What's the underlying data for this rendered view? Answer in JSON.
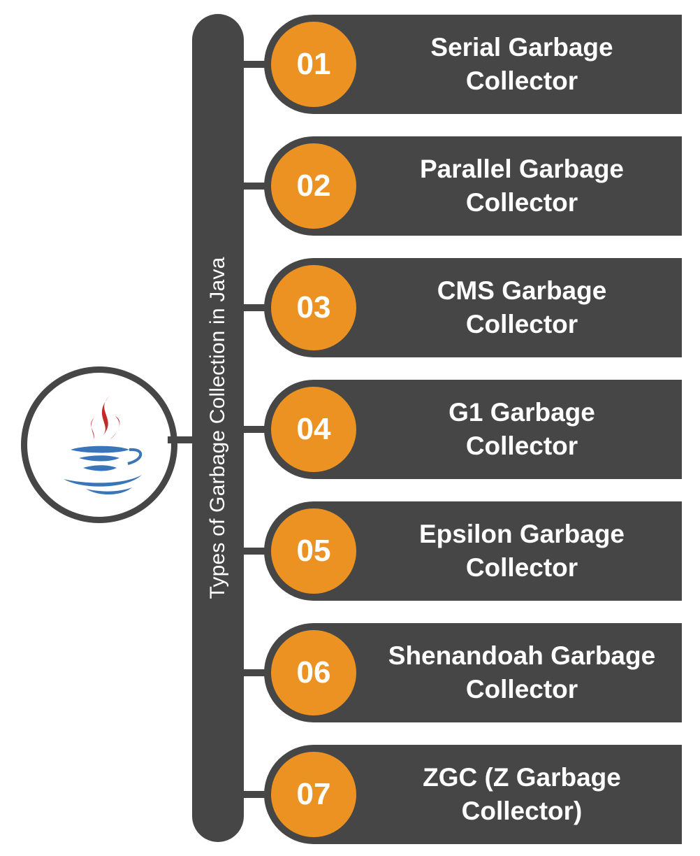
{
  "title": "Types of Garbage Collection in Java",
  "logo": {
    "icon": "java-coffee-cup-icon",
    "colors": {
      "steam": "#c32a2a",
      "cup": "#3a75b9"
    }
  },
  "colors": {
    "dark": "#464646",
    "accent": "#ec9222",
    "text": "#ffffff"
  },
  "items": [
    {
      "number": "01",
      "line1": "Serial Garbage",
      "line2": "Collector"
    },
    {
      "number": "02",
      "line1": "Parallel Garbage",
      "line2": "Collector"
    },
    {
      "number": "03",
      "line1": "CMS Garbage",
      "line2": "Collector"
    },
    {
      "number": "04",
      "line1": "G1 Garbage",
      "line2": "Collector"
    },
    {
      "number": "05",
      "line1": "Epsilon Garbage",
      "line2": "Collector"
    },
    {
      "number": "06",
      "line1": "Shenandoah Garbage",
      "line2": "Collector"
    },
    {
      "number": "07",
      "line1": "ZGC (Z Garbage",
      "line2": "Collector)"
    }
  ]
}
